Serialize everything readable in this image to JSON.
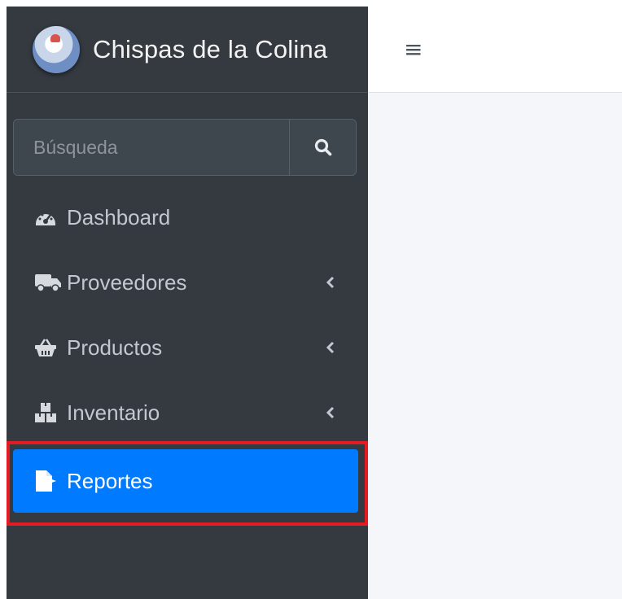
{
  "brand": {
    "name": "Chispas de la Colina",
    "logo_icon": "rooster-logo"
  },
  "search": {
    "placeholder": "Búsqueda",
    "value": "",
    "icon": "search-icon"
  },
  "nav": {
    "items": [
      {
        "label": "Dashboard",
        "icon": "tachometer-icon",
        "has_chevron": false
      },
      {
        "label": "Proveedores",
        "icon": "truck-icon",
        "has_chevron": true
      },
      {
        "label": "Productos",
        "icon": "basket-icon",
        "has_chevron": true
      },
      {
        "label": "Inventario",
        "icon": "boxes-icon",
        "has_chevron": true
      },
      {
        "label": "Reportes",
        "icon": "file-export-icon",
        "has_chevron": false,
        "active": true
      }
    ]
  },
  "topbar": {
    "menu_icon": "hamburger-icon",
    "menu_glyph": "≡"
  },
  "colors": {
    "sidebar_bg": "#343a40",
    "active_bg": "#007bff",
    "highlight_outline": "#e31b23",
    "content_bg": "#f4f6f9"
  }
}
